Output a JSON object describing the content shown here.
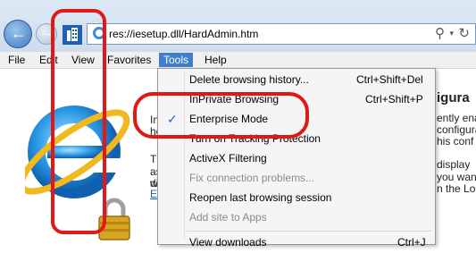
{
  "address_bar": {
    "url": "res://iesetup.dll/HardAdmin.htm"
  },
  "menubar": {
    "file": "File",
    "edit": "Edit",
    "view": "View",
    "favorites": "Favorites",
    "tools": "Tools",
    "help": "Help"
  },
  "tools_menu": {
    "items": [
      {
        "label": "Delete browsing history...",
        "shortcut": "Ctrl+Shift+Del"
      },
      {
        "label": "InPrivate Browsing",
        "shortcut": "Ctrl+Shift+P"
      },
      {
        "label": "Enterprise Mode",
        "shortcut": ""
      },
      {
        "label": "Turn on Tracking Protection",
        "shortcut": ""
      },
      {
        "label": "ActiveX Filtering",
        "shortcut": ""
      },
      {
        "label": "Fix connection problems...",
        "shortcut": ""
      },
      {
        "label": "Reopen last browsing session",
        "shortcut": ""
      },
      {
        "label": "Add site to Apps",
        "shortcut": ""
      },
      {
        "label": "View downloads",
        "shortcut": "Ctrl+J"
      }
    ]
  },
  "background_text": {
    "right_heading": "igura",
    "right_line1": "ently ena",
    "right_line2": "configurat",
    "right_line3": "his conf",
    "right_line4": "display",
    "right_line5": "you wan",
    "right_line6": "n the Lo",
    "left_frag1": "Th",
    "left_frag2": "as",
    "left_frag3": "wi",
    "left_frag4": "di",
    "left_frag5": "Ex",
    "left_frag6": "In",
    "left_frag7": "he"
  },
  "colors": {
    "accent": "#3f7fd0",
    "annotation": "#e01818"
  }
}
